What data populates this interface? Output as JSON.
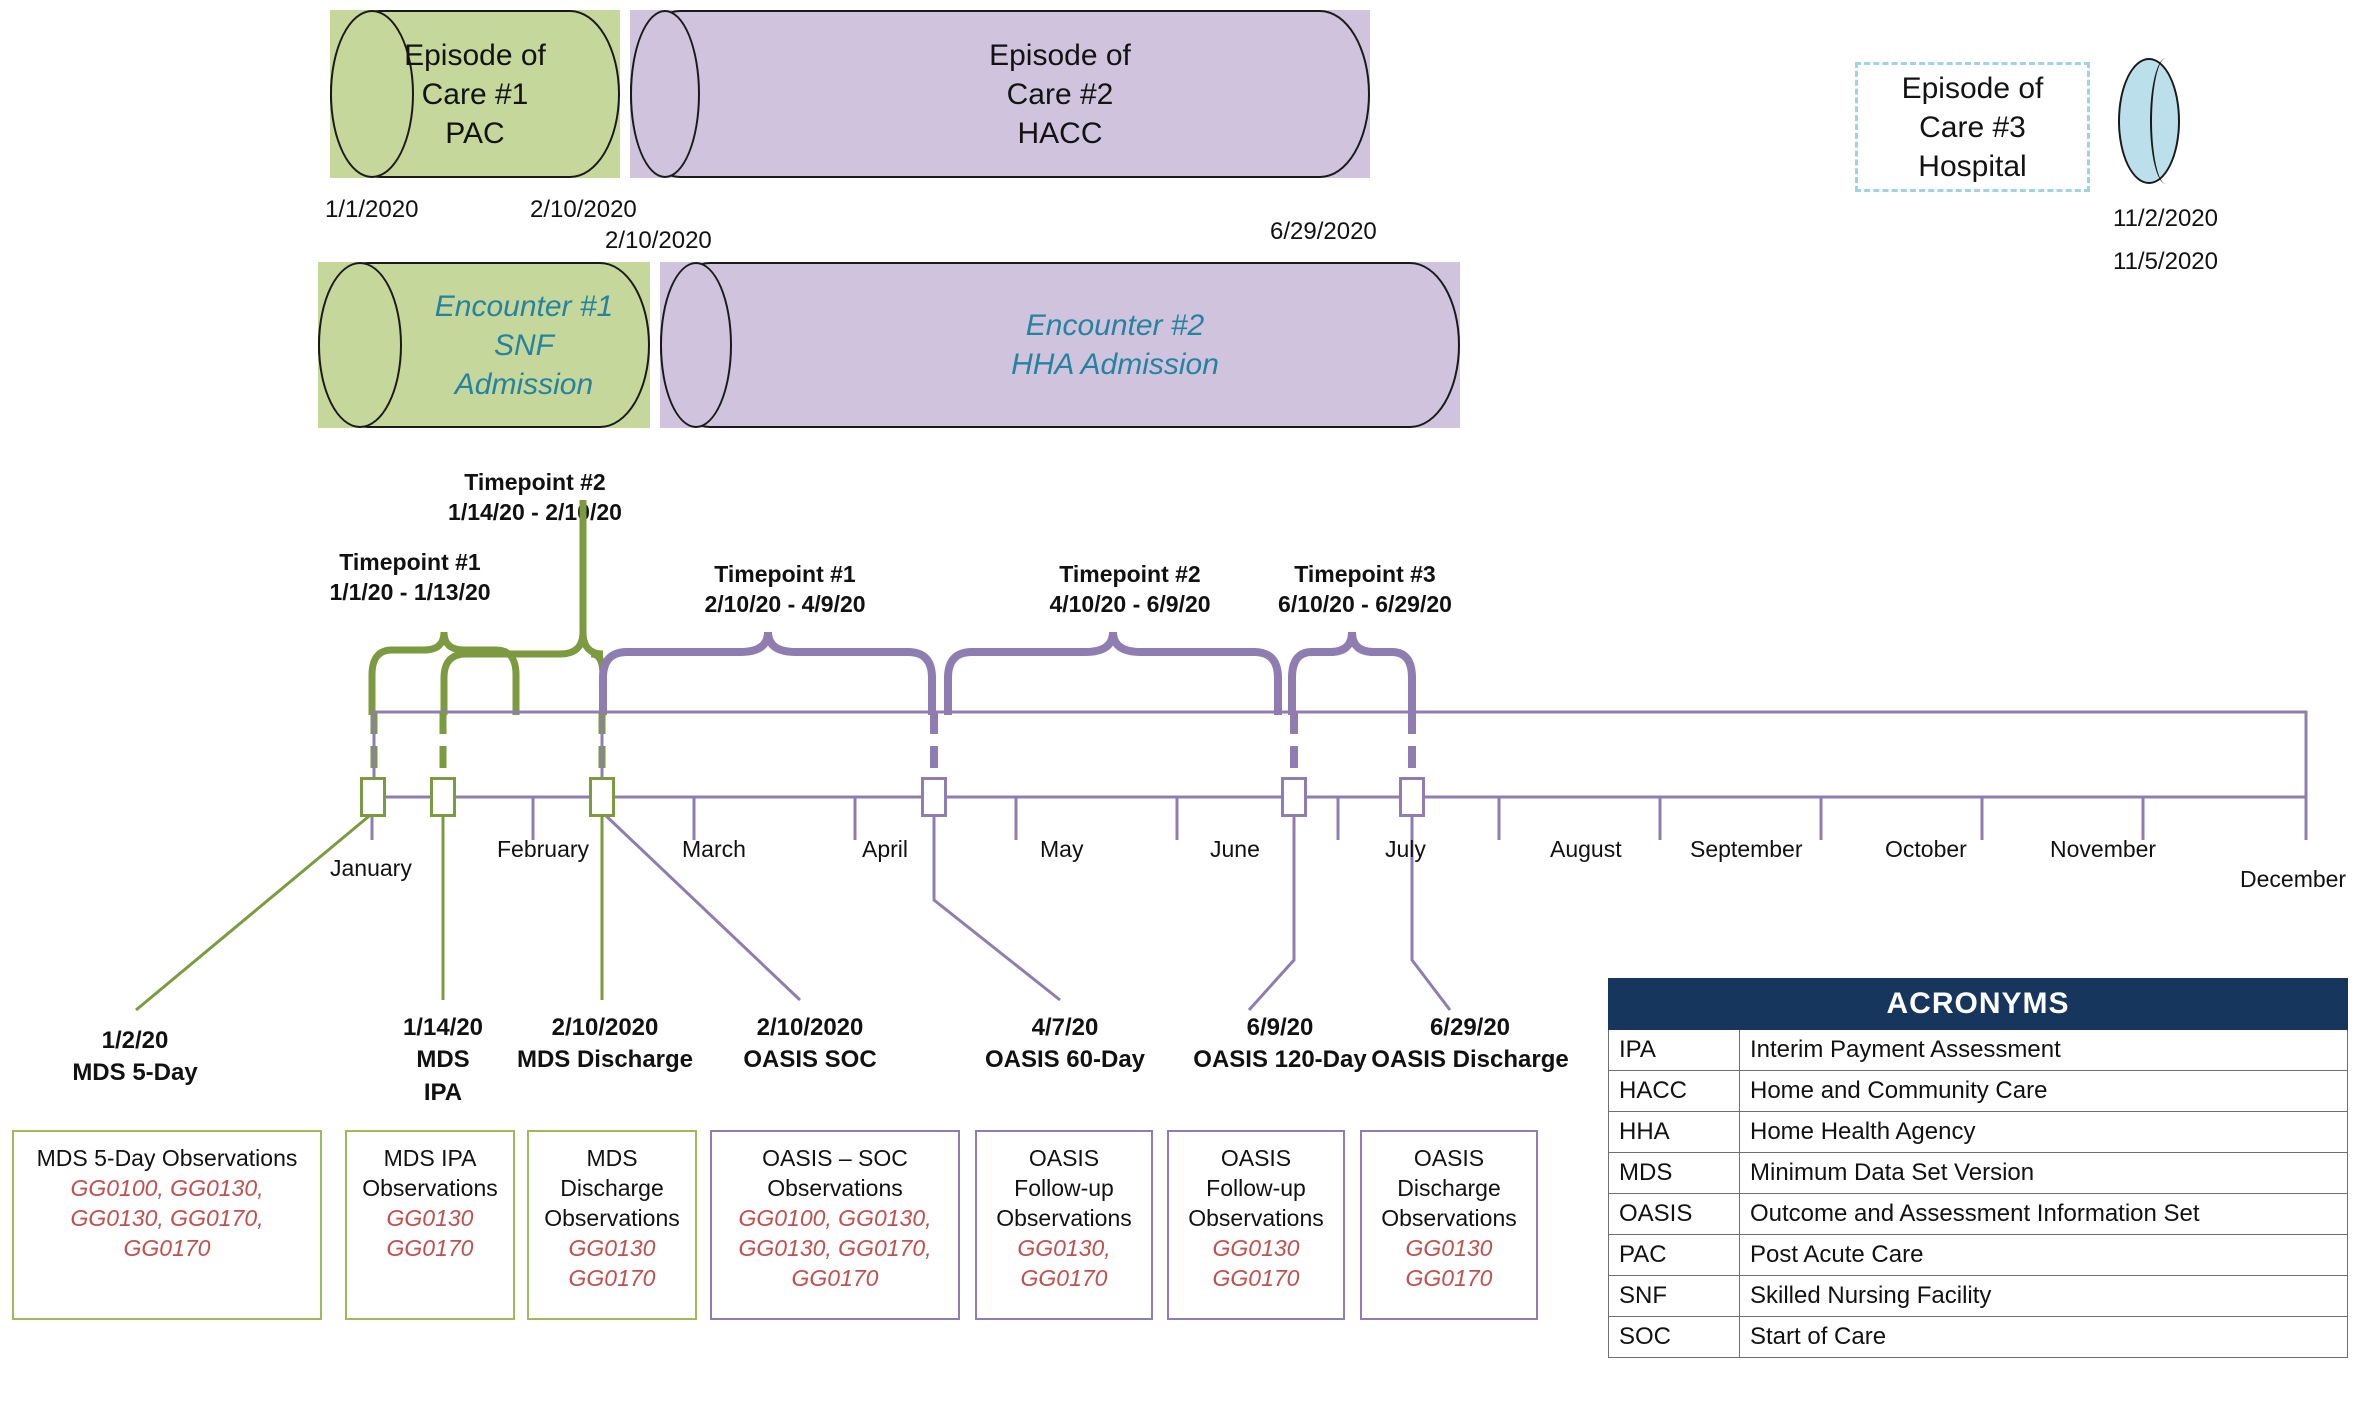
{
  "episodes": [
    {
      "title_l1": "Episode of",
      "title_l2": "Care #1",
      "title_l3": "PAC",
      "color": "#c5d79a",
      "start": "1/1/2020",
      "end": "2/10/2020"
    },
    {
      "title_l1": "Episode of",
      "title_l2": "Care #2",
      "title_l3": "HACC",
      "color": "#cfc3dd",
      "start": "2/10/2020",
      "end": "6/29/2020"
    },
    {
      "title_l1": "Episode of",
      "title_l2": "Care #3",
      "title_l3": "Hospital",
      "color": "#bbdfeb",
      "start": "11/2/2020",
      "end": "11/5/2020"
    }
  ],
  "encounters": [
    {
      "title_l1": "Encounter #1",
      "title_l2": "SNF",
      "title_l3": "Admission",
      "color": "#c5d79a"
    },
    {
      "title_l1": "Encounter #2",
      "title_l2": "HHA Admission",
      "title_l3": "",
      "color": "#cfc3dd"
    }
  ],
  "timepoints": [
    {
      "name": "Timepoint #1",
      "range": "1/1/20 - 1/13/20",
      "group": "pac"
    },
    {
      "name": "Timepoint #2",
      "range": "1/14/20 - 2/10/20",
      "group": "pac"
    },
    {
      "name": "Timepoint #1",
      "range": "2/10/20 - 4/9/20",
      "group": "hacc"
    },
    {
      "name": "Timepoint #2",
      "range": "4/10/20 - 6/9/20",
      "group": "hacc"
    },
    {
      "name": "Timepoint #3",
      "range": "6/10/20 - 6/29/20",
      "group": "hacc"
    }
  ],
  "months": [
    "January",
    "February",
    "March",
    "April",
    "May",
    "June",
    "July",
    "August",
    "September",
    "October",
    "November",
    "December"
  ],
  "events": [
    {
      "date": "1/2/20",
      "label": "MDS 5-Day"
    },
    {
      "date": "1/14/20",
      "label": "MDS\nIPA"
    },
    {
      "date": "2/10/2020",
      "label": "MDS Discharge"
    },
    {
      "date": "2/10/2020",
      "label": "OASIS SOC"
    },
    {
      "date": "4/7/20",
      "label": "OASIS 60-Day"
    },
    {
      "date": "6/9/20",
      "label": "OASIS 120-Day"
    },
    {
      "date": "6/29/20",
      "label": "OASIS Discharge"
    }
  ],
  "observation_boxes": [
    {
      "header": "MDS 5-Day Observations",
      "items": "GG0100, GG0130,\nGG0130, GG0170,\nGG0170",
      "accent": "green"
    },
    {
      "header": "MDS IPA\nObservations",
      "items": "GG0130\nGG0170",
      "accent": "green"
    },
    {
      "header": "MDS\nDischarge\nObservations",
      "items": "GG0130\nGG0170",
      "accent": "green"
    },
    {
      "header": "OASIS – SOC\nObservations",
      "items": "GG0100, GG0130,\nGG0130, GG0170,\nGG0170",
      "accent": "purple"
    },
    {
      "header": "OASIS\nFollow-up\nObservations",
      "items": "GG0130,\nGG0170",
      "accent": "purple"
    },
    {
      "header": "OASIS\nFollow-up\nObservations",
      "items": "GG0130\nGG0170",
      "accent": "purple"
    },
    {
      "header": "OASIS\nDischarge\nObservations",
      "items": "GG0130\nGG0170",
      "accent": "purple"
    }
  ],
  "acronyms": {
    "title": "ACRONYMS",
    "rows": [
      {
        "key": "IPA",
        "value": "Interim Payment Assessment"
      },
      {
        "key": "HACC",
        "value": "Home and Community Care"
      },
      {
        "key": "HHA",
        "value": "Home Health Agency"
      },
      {
        "key": "MDS",
        "value": "Minimum Data Set Version"
      },
      {
        "key": "OASIS",
        "value": "Outcome and Assessment Information Set"
      },
      {
        "key": "PAC",
        "value": "Post Acute Care"
      },
      {
        "key": "SNF",
        "value": "Skilled Nursing Facility"
      },
      {
        "key": "SOC",
        "value": "Start of Care"
      }
    ]
  },
  "colors": {
    "green": "#7c9a3f",
    "purple": "#8f7cb0",
    "teal": "#2683a0",
    "red": "#c0504d",
    "navy": "#17365d"
  }
}
